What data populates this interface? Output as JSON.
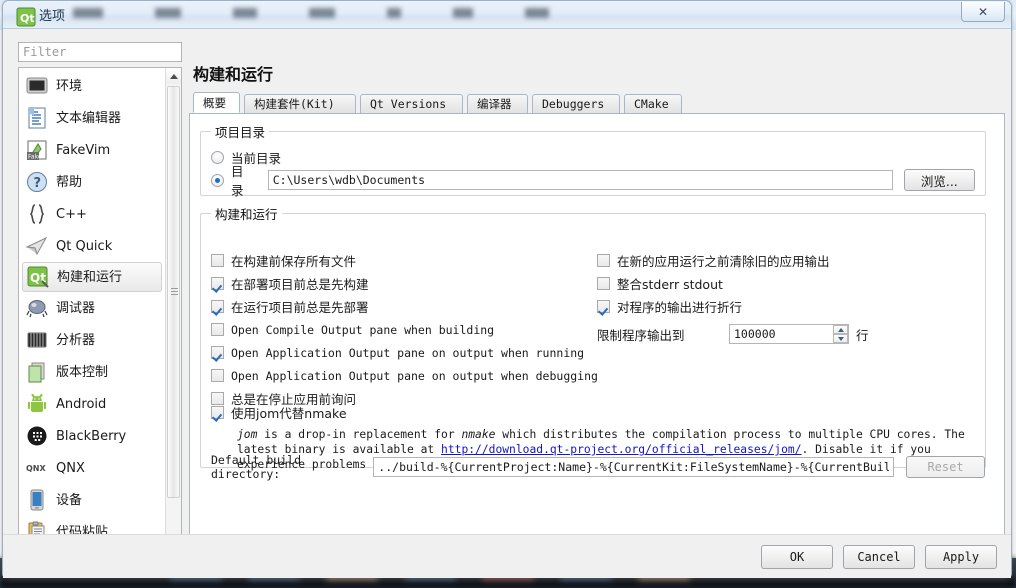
{
  "window": {
    "title": "选项",
    "app_icon": "qt-logo-icon",
    "close_label": "✕"
  },
  "filter": {
    "placeholder": "Filter",
    "value": ""
  },
  "sidebar": {
    "items": [
      {
        "label": "环境",
        "icon": "monitor-icon",
        "selected": false
      },
      {
        "label": "文本编辑器",
        "icon": "text-editor-icon",
        "selected": false
      },
      {
        "label": "FakeVim",
        "icon": "fakevim-icon",
        "selected": false
      },
      {
        "label": "帮助",
        "icon": "help-question-icon",
        "selected": false
      },
      {
        "label": "C++",
        "icon": "braces-icon",
        "selected": false
      },
      {
        "label": "Qt Quick",
        "icon": "paper-plane-icon",
        "selected": false
      },
      {
        "label": "构建和运行",
        "icon": "qt-build-icon",
        "selected": true
      },
      {
        "label": "调试器",
        "icon": "bug-icon",
        "selected": false
      },
      {
        "label": "分析器",
        "icon": "analyzer-icon",
        "selected": false
      },
      {
        "label": "版本控制",
        "icon": "version-control-icon",
        "selected": false
      },
      {
        "label": "Android",
        "icon": "android-icon",
        "selected": false
      },
      {
        "label": "BlackBerry",
        "icon": "blackberry-icon",
        "selected": false
      },
      {
        "label": "QNX",
        "icon": "qnx-icon",
        "selected": false
      },
      {
        "label": "设备",
        "icon": "device-phone-icon",
        "selected": false
      },
      {
        "label": "代码粘贴",
        "icon": "clipboard-paste-icon",
        "selected": false
      }
    ],
    "scrollbar": {
      "up_arrow": "▲",
      "down_arrow": "▼"
    }
  },
  "page": {
    "title": "构建和运行",
    "tabs": [
      {
        "label": "概要",
        "active": true
      },
      {
        "label": "构建套件(Kit)",
        "active": false
      },
      {
        "label": "Qt Versions",
        "active": false
      },
      {
        "label": "编译器",
        "active": false
      },
      {
        "label": "Debuggers",
        "active": false
      },
      {
        "label": "CMake",
        "active": false
      }
    ]
  },
  "project_directory_group": {
    "legend": "项目目录",
    "radio_current": {
      "label": "当前目录",
      "checked": false
    },
    "radio_directory": {
      "label": "目录",
      "checked": true
    },
    "path_value": "C:\\Users\\wdb\\Documents",
    "browse_button": "浏览..."
  },
  "build_run_group": {
    "legend": "构建和运行",
    "left_checkboxes": [
      {
        "label": "在构建前保存所有文件",
        "checked": false,
        "mono": false
      },
      {
        "label": "在部署项目前总是先构建",
        "checked": true,
        "mono": false
      },
      {
        "label": "在运行项目前总是先部署",
        "checked": true,
        "mono": false
      },
      {
        "label": "Open Compile Output pane when building",
        "checked": false,
        "mono": true
      },
      {
        "label": "Open Application Output pane on output when running",
        "checked": true,
        "mono": true
      },
      {
        "label": "Open Application Output pane on output when debugging",
        "checked": false,
        "mono": true
      },
      {
        "label": "总是在停止应用前询问",
        "checked": false,
        "mono": false
      }
    ],
    "right_checkboxes": [
      {
        "label": "在新的应用运行之前清除旧的应用输出",
        "checked": false,
        "mono": false
      },
      {
        "label": "整合stderr stdout",
        "checked": false,
        "mono": false
      },
      {
        "label": "对程序的输出进行折行",
        "checked": true,
        "mono": false
      }
    ],
    "limit_output": {
      "label": "限制程序输出到",
      "value": "100000",
      "suffix": "行"
    },
    "jom": {
      "checkbox_label": "使用jom代替nmake",
      "checked": true,
      "desc_part1": "jom",
      "desc_part2": " is a drop-in replacement for ",
      "desc_part3": "nmake",
      "desc_part4": " which distributes the compilation process to multiple CPU cores. The latest binary is available at ",
      "link_text": "http://download.qt-project.org/official_releases/jom/",
      "desc_part5": ". Disable it if you experience problems with your builds."
    },
    "default_build_directory": {
      "label": "Default build directory:",
      "value": "../build-%{CurrentProject:Name}-%{CurrentKit:FileSystemName}-%{CurrentBuild:Name}",
      "reset_button": "Reset",
      "reset_enabled": false
    }
  },
  "footer": {
    "ok": "OK",
    "cancel": "Cancel",
    "apply": "Apply"
  },
  "colors": {
    "accent_blue": "#1b6fc4",
    "link": "#1414c8",
    "window_bg": "#f0f0f0",
    "pane_bg": "#ffffff",
    "border": "#a9b7c6"
  }
}
